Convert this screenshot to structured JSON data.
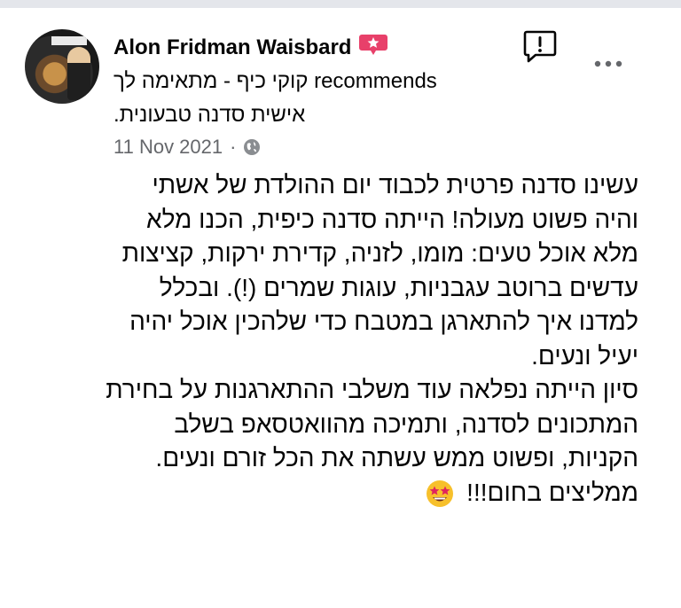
{
  "post": {
    "author": "Alon Fridman Waisbard",
    "recommends_line1": "קוקי כיף - מתאימה לך recommends",
    "recommends_line2": ".אישית סדנה טבעונית",
    "date": "11 Nov 2021",
    "separator": "·",
    "privacy_icon": "globe-icon",
    "badge_icon": "star-badge-icon",
    "report_icon": "report-icon",
    "more_icon": "more-options-icon",
    "body_lines": [
      "עשינו סדנה פרטית לכבוד יום ההולדת של אשתי",
      "והיה פשוט מעולה! הייתה סדנה כיפית, הכנו מלא",
      "מלא אוכל טעים: מומו, לזניה, קדירת ירקות, קציצות",
      "עדשים ברוטב עגבניות, עוגות שמרים (!). ובכלל",
      "למדנו איך להתארגן במטבח כדי שלהכין אוכל יהיה",
      "יעיל ונעים.",
      "סיון הייתה נפלאה עוד משלבי ההתארגנות על בחירת",
      "המתכונים לסדנה, ותמיכה מהוואטסאפ בשלב",
      "הקניות, ופשוט ממש עשתה את הכל זורם ונעים.",
      "ממליצים בחום!!!"
    ],
    "closing_emoji": "star-struck-emoji"
  },
  "colors": {
    "text": "#050505",
    "meta": "#65676b",
    "badge": "#e8406a",
    "divider": "#e4e6eb"
  }
}
